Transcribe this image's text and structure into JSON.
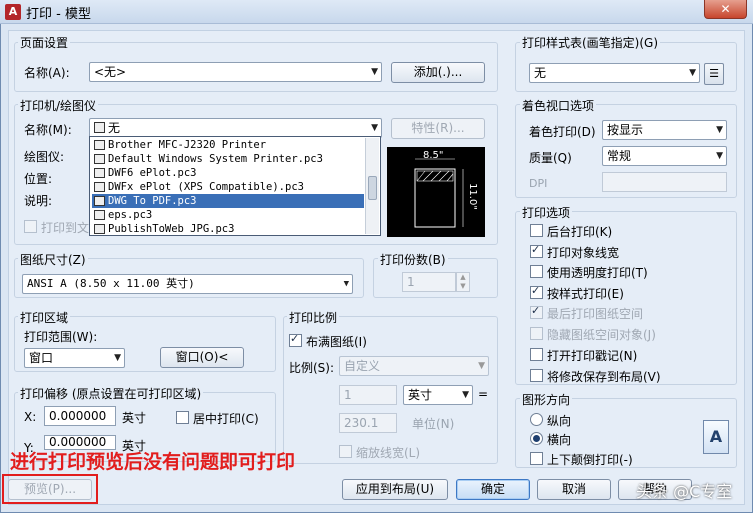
{
  "window": {
    "title": "打印 - 模型",
    "close_label": "✕"
  },
  "page_setup": {
    "group_title": "页面设置",
    "name_label": "名称(A):",
    "name_value": "<无>",
    "add_button": "添加(.)..."
  },
  "printer": {
    "group_title": "打印机/绘图仪",
    "name_label": "名称(M):",
    "name_value": "无",
    "properties_button": "特性(R)...",
    "plotter_label": "绘图仪:",
    "location_label": "位置:",
    "description_label": "说明:",
    "print_to_file_label": "打印到文",
    "list_items": [
      "Brother MFC-J2320 Printer",
      "Default Windows System Printer.pc3",
      "DWF6 ePlot.pc3",
      "DWFx ePlot (XPS Compatible).pc3",
      "DWG To PDF.pc3",
      "eps.pc3",
      "PublishToWeb JPG.pc3"
    ],
    "selected_index": 4,
    "preview_width": "8.5\"",
    "preview_height": "11.0\""
  },
  "paper_size": {
    "group_title": "图纸尺寸(Z)",
    "value": "ANSI A (8.50 x 11.00 英寸)"
  },
  "copies": {
    "group_title": "打印份数(B)",
    "value": "1"
  },
  "plot_area": {
    "group_title": "打印区域",
    "range_label": "打印范围(W):",
    "range_value": "窗口",
    "window_button": "窗口(O)<"
  },
  "plot_offset": {
    "group_title": "打印偏移 (原点设置在可打印区域)",
    "x_label": "X:",
    "x_value": "0.000000",
    "x_unit": "英寸",
    "center_label": "居中打印(C)",
    "y_label": "Y:",
    "y_value": "0.000000",
    "y_unit": "英寸"
  },
  "plot_scale": {
    "group_title": "打印比例",
    "fit_label": "布满图纸(I)",
    "scale_label": "比例(S):",
    "scale_value": "自定义",
    "num_value": "1",
    "unit_value": "英寸",
    "eq_sign": "=",
    "den_value": "230.1",
    "den_unit": "单位(N)",
    "lineweight_label": "缩放线宽(L)"
  },
  "style_table": {
    "group_title": "打印样式表(画笔指定)(G)",
    "value": "无"
  },
  "shaded_viewport": {
    "group_title": "着色视口选项",
    "shade_label": "着色打印(D)",
    "shade_value": "按显示",
    "quality_label": "质量(Q)",
    "quality_value": "常规",
    "dpi_label": "DPI"
  },
  "plot_options": {
    "group_title": "打印选项",
    "items": [
      {
        "label": "后台打印(K)",
        "checked": false,
        "disabled": false
      },
      {
        "label": "打印对象线宽",
        "checked": true,
        "disabled": false
      },
      {
        "label": "使用透明度打印(T)",
        "checked": false,
        "disabled": false
      },
      {
        "label": "按样式打印(E)",
        "checked": true,
        "disabled": false
      },
      {
        "label": "最后打印图纸空间",
        "checked": true,
        "disabled": true
      },
      {
        "label": "隐藏图纸空间对象(J)",
        "checked": false,
        "disabled": true
      },
      {
        "label": "打开打印戳记(N)",
        "checked": false,
        "disabled": false
      },
      {
        "label": "将修改保存到布局(V)",
        "checked": false,
        "disabled": false
      }
    ]
  },
  "orientation": {
    "group_title": "图形方向",
    "portrait_label": "纵向",
    "landscape_label": "横向",
    "upside_down_label": "上下颠倒打印(-)",
    "icon_letter": "A"
  },
  "footer": {
    "preview_button": "预览(P)...",
    "apply_button": "应用到布局(U)",
    "ok_button": "确定",
    "cancel_button": "取消",
    "help_button": "帮助"
  },
  "annotation": {
    "overlay_text": "进行打印预览后没有问题即可打印",
    "watermark": "头条 @C专室"
  }
}
